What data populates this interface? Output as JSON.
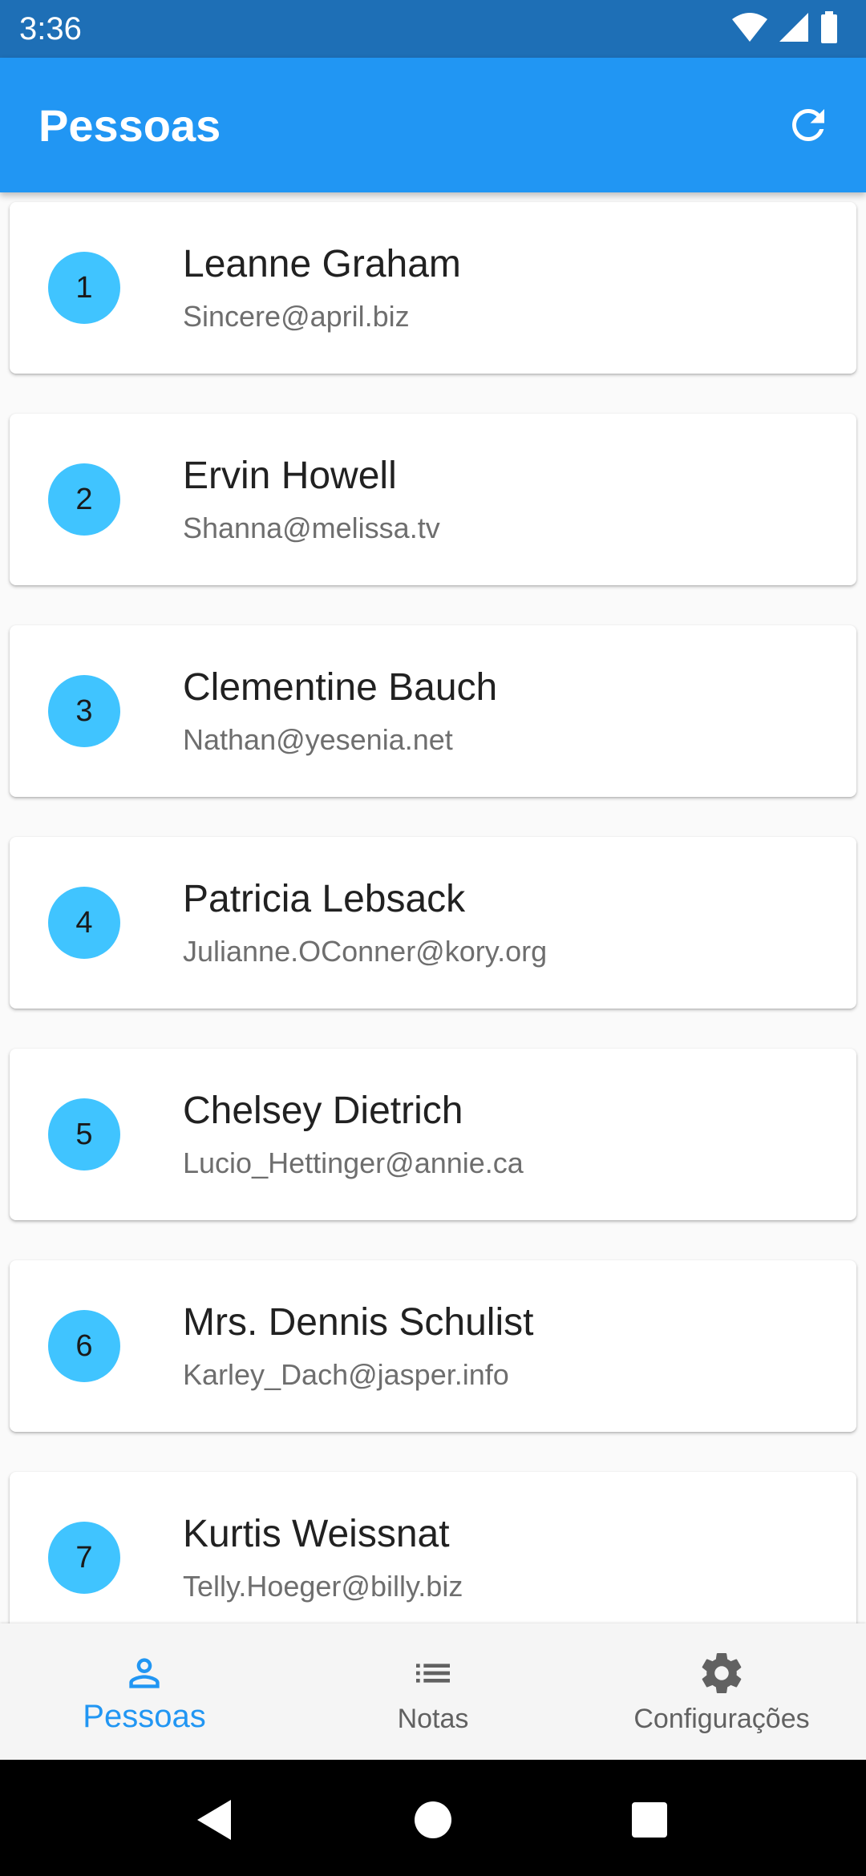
{
  "status_bar": {
    "time": "3:36"
  },
  "app_bar": {
    "title": "Pessoas",
    "refresh_icon": "refresh-icon"
  },
  "people": [
    {
      "id": "1",
      "name": "Leanne Graham",
      "email": "Sincere@april.biz"
    },
    {
      "id": "2",
      "name": "Ervin Howell",
      "email": "Shanna@melissa.tv"
    },
    {
      "id": "3",
      "name": "Clementine Bauch",
      "email": "Nathan@yesenia.net"
    },
    {
      "id": "4",
      "name": "Patricia Lebsack",
      "email": "Julianne.OConner@kory.org"
    },
    {
      "id": "5",
      "name": "Chelsey Dietrich",
      "email": "Lucio_Hettinger@annie.ca"
    },
    {
      "id": "6",
      "name": "Mrs. Dennis Schulist",
      "email": "Karley_Dach@jasper.info"
    },
    {
      "id": "7",
      "name": "Kurtis Weissnat",
      "email": "Telly.Hoeger@billy.biz"
    }
  ],
  "bottom_nav": {
    "items": [
      {
        "label": "Pessoas",
        "icon": "person-icon",
        "active": true
      },
      {
        "label": "Notas",
        "icon": "list-icon",
        "active": false
      },
      {
        "label": "Configurações",
        "icon": "gear-icon",
        "active": false
      }
    ]
  },
  "colors": {
    "status_bar": "#1e6fb6",
    "app_bar": "#2196f3",
    "avatar": "#40c4ff",
    "active_nav": "#2196f3",
    "inactive_nav": "#616161"
  }
}
